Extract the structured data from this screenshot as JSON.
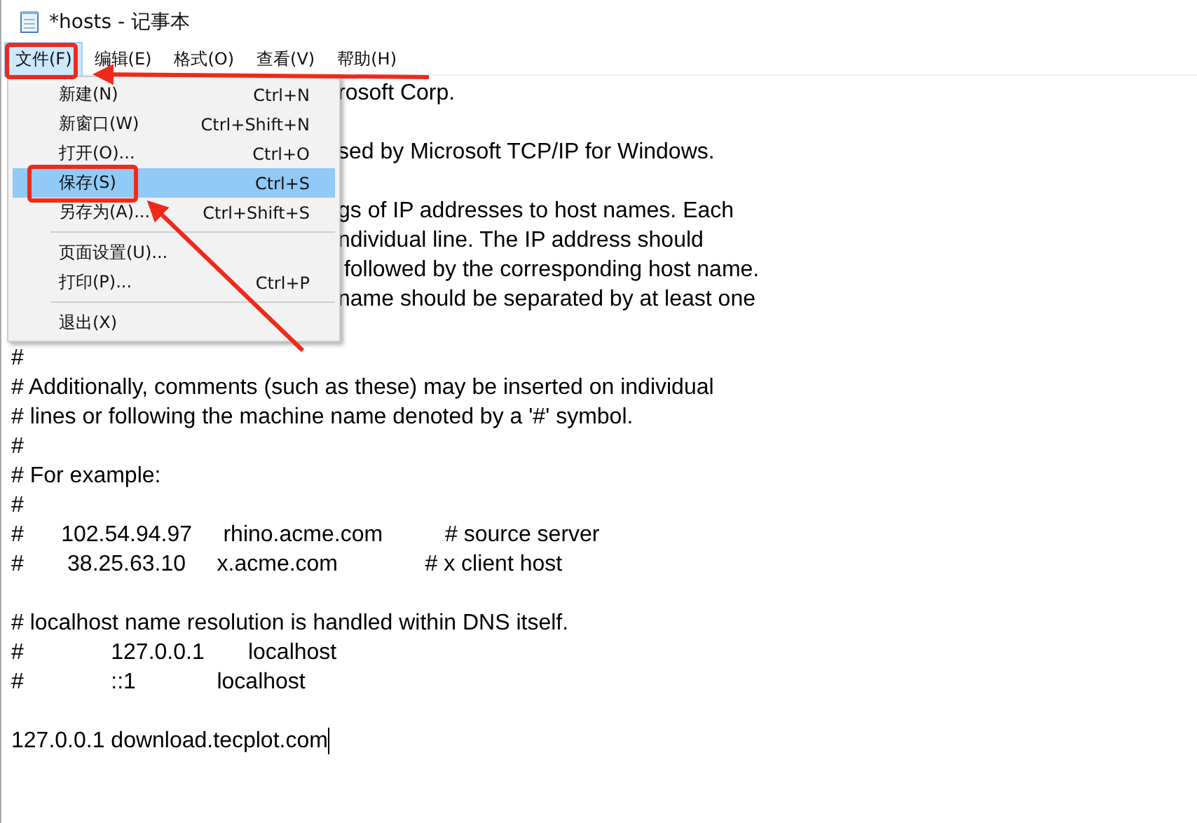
{
  "window": {
    "title": "*hosts - 记事本"
  },
  "menu_bar": [
    {
      "label": "文件(F)",
      "selected": true
    },
    {
      "label": "编辑(E)",
      "selected": false
    },
    {
      "label": "格式(O)",
      "selected": false
    },
    {
      "label": "查看(V)",
      "selected": false
    },
    {
      "label": "帮助(H)",
      "selected": false
    }
  ],
  "file_menu": [
    {
      "kind": "item",
      "label": "新建(N)",
      "shortcut": "Ctrl+N",
      "selected": false
    },
    {
      "kind": "item",
      "label": "新窗口(W)",
      "shortcut": "Ctrl+Shift+N",
      "selected": false
    },
    {
      "kind": "item",
      "label": "打开(O)...",
      "shortcut": "Ctrl+O",
      "selected": false
    },
    {
      "kind": "item",
      "label": "保存(S)",
      "shortcut": "Ctrl+S",
      "selected": true
    },
    {
      "kind": "item",
      "label": "另存为(A)...",
      "shortcut": "Ctrl+Shift+S",
      "selected": false
    },
    {
      "kind": "separator"
    },
    {
      "kind": "item",
      "label": "页面设置(U)...",
      "selected": false
    },
    {
      "kind": "item",
      "label": "打印(P)...",
      "shortcut": "Ctrl+P",
      "selected": false
    },
    {
      "kind": "separator"
    },
    {
      "kind": "item",
      "label": "退出(X)",
      "selected": false
    }
  ],
  "editor": {
    "lines": [
      {
        "kind": "partial",
        "text": "rosoft Corp."
      },
      {
        "kind": "blank"
      },
      {
        "kind": "partial",
        "text": "sed by Microsoft TCP/IP for Windows."
      },
      {
        "kind": "blank"
      },
      {
        "kind": "partial",
        "text": "gs of IP addresses to host names. Each"
      },
      {
        "kind": "partial",
        "text": "ndividual line. The IP address should"
      },
      {
        "kind": "partial",
        "text": " followed by the corresponding host name."
      },
      {
        "kind": "partial",
        "text": "name should be separated by at least one"
      },
      {
        "kind": "blank"
      },
      {
        "kind": "text",
        "text": "#"
      },
      {
        "kind": "text",
        "text": "# Additionally, comments (such as these) may be inserted on individual"
      },
      {
        "kind": "text",
        "text": "# lines or following the machine name denoted by a '#' symbol."
      },
      {
        "kind": "text",
        "text": "#"
      },
      {
        "kind": "text",
        "text": "# For example:"
      },
      {
        "kind": "text",
        "text": "#"
      },
      {
        "kind": "text",
        "text": "#      102.54.94.97     rhino.acme.com          # source server"
      },
      {
        "kind": "text",
        "text": "#       38.25.63.10     x.acme.com              # x client host"
      },
      {
        "kind": "blank"
      },
      {
        "kind": "text",
        "text": "# localhost name resolution is handled within DNS itself."
      },
      {
        "kind": "text",
        "text": "#              127.0.0.1       localhost"
      },
      {
        "kind": "text",
        "text": "#              ::1             localhost"
      },
      {
        "kind": "blank"
      },
      {
        "kind": "text",
        "text": "127.0.0.1 download.tecplot.com",
        "caret": true
      }
    ]
  }
}
